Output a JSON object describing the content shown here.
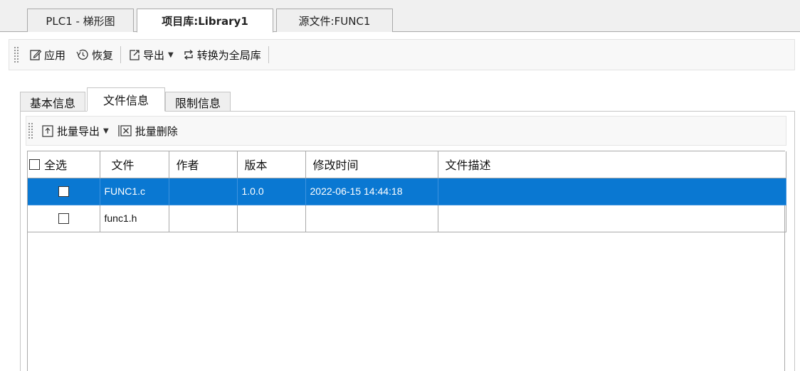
{
  "doc_tabs": [
    {
      "label": "PLC1 - 梯形图"
    },
    {
      "label": "项目库:Library1"
    },
    {
      "label": "源文件:FUNC1"
    }
  ],
  "toolbar": {
    "apply_label": "应用",
    "restore_label": "恢复",
    "export_label": "导出",
    "convert_label": "转换为全局库"
  },
  "sub_tabs": [
    {
      "label": "基本信息"
    },
    {
      "label": "文件信息"
    },
    {
      "label": "限制信息"
    }
  ],
  "sub_toolbar": {
    "batch_export_label": "批量导出",
    "batch_delete_label": "批量删除"
  },
  "table": {
    "select_all_label": "全选",
    "columns": [
      "文件",
      "作者",
      "版本",
      "修改时间",
      "文件描述"
    ],
    "rows": [
      {
        "file": "FUNC1.c",
        "author": "",
        "version": "1.0.0",
        "modified": "2022-06-15 14:44:18",
        "description": "",
        "selected": true
      },
      {
        "file": "func1.h",
        "author": "",
        "version": "",
        "modified": "",
        "description": "",
        "selected": false
      }
    ]
  },
  "colors": {
    "selection": "#0a78d2",
    "border": "#a9a9a9"
  },
  "icons": [
    "edit-icon",
    "history-icon",
    "export-icon",
    "convert-icon",
    "batch-export-icon",
    "batch-delete-icon",
    "dropdown-caret-icon"
  ]
}
